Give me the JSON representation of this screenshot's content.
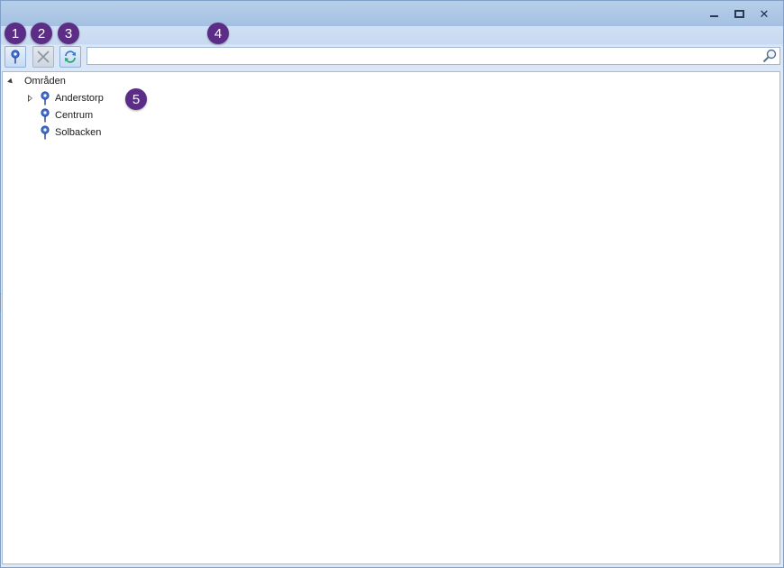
{
  "window": {
    "controls": [
      "minimize-icon",
      "maximize-icon",
      "close-icon"
    ],
    "close_glyph": "✕"
  },
  "toolbar": {
    "add_icon": "map-pin-icon",
    "delete_icon": "delete-x-icon",
    "refresh_icon": "refresh-icon"
  },
  "search": {
    "value": "",
    "placeholder": "",
    "icon": "search-icon"
  },
  "tree": {
    "root": {
      "label": "Områden",
      "expanded": true
    },
    "children": [
      {
        "label": "Anderstorp",
        "has_children": true,
        "expanded": false
      },
      {
        "label": "Centrum",
        "has_children": false
      },
      {
        "label": "Solbacken",
        "has_children": false
      }
    ]
  },
  "annotations": [
    "1",
    "2",
    "3",
    "4",
    "5"
  ],
  "colors": {
    "badge": "#5b2d86",
    "titlebar": "#b7cfe9",
    "pin": "#3f6fd1"
  }
}
